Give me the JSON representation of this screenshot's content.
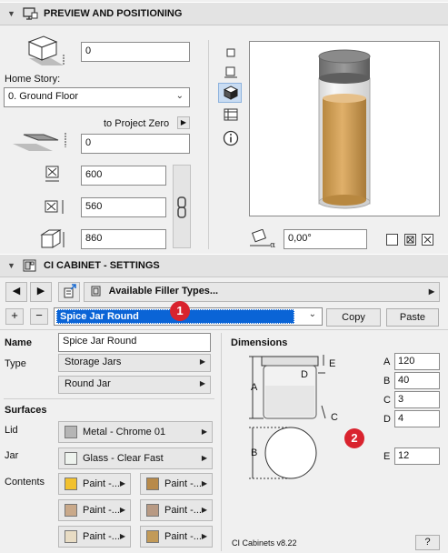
{
  "preview_panel": {
    "title": "PREVIEW AND POSITIONING",
    "elevation_value": "0",
    "home_story_label": "Home Story:",
    "home_story_value": "0. Ground Floor",
    "to_project_zero_label": "to Project Zero",
    "project_zero_value": "0",
    "width_value": "600",
    "depth_value": "560",
    "height_value": "860",
    "rotation_value": "0,00°",
    "view_buttons": [
      "plan-view",
      "front-view",
      "3d-view",
      "section-view",
      "info"
    ]
  },
  "settings_panel": {
    "title": "CI CABINET - SETTINGS",
    "filler_types_label": "Available Filler Types...",
    "selected_filler": "Spice Jar Round",
    "copy_label": "Copy",
    "paste_label": "Paste",
    "badge1": "1",
    "badge2": "2",
    "name_label": "Name",
    "name_value": "Spice Jar Round",
    "type_label": "Type",
    "type_value": "Storage Jars",
    "subtype_value": "Round Jar",
    "surfaces_label": "Surfaces",
    "lid_label": "Lid",
    "lid_value": "Metal - Chrome 01",
    "jar_label": "Jar",
    "jar_value": "Glass - Clear Fast",
    "contents_label": "Contents",
    "contents": [
      {
        "label": "Paint -...",
        "color": "#f2c12e"
      },
      {
        "label": "Paint -...",
        "color": "#b88a4a"
      },
      {
        "label": "Paint -...",
        "color": "#c9a98a"
      },
      {
        "label": "Paint -...",
        "color": "#b89a84"
      },
      {
        "label": "Paint -...",
        "color": "#e8dcc4"
      },
      {
        "label": "Paint -...",
        "color": "#c29a58"
      }
    ],
    "dimensions_label": "Dimensions",
    "dims": {
      "A_label": "A",
      "A_value": "120",
      "B_label": "B",
      "B_value": "40",
      "C_label": "C",
      "C_value": "3",
      "D_label": "D",
      "D_value": "4",
      "E_label": "E",
      "E_value": "12"
    },
    "diagram_labels": {
      "A": "A",
      "B": "B",
      "C": "C",
      "D": "D",
      "E": "E"
    },
    "version": "CI Cabinets v8.22",
    "help_label": "?"
  },
  "colors": {
    "lid_swatch": "#b5b5b5",
    "jar_swatch": "#eef3ee",
    "selected_highlight": "#0a64d6",
    "badge_red": "#d9232e"
  }
}
